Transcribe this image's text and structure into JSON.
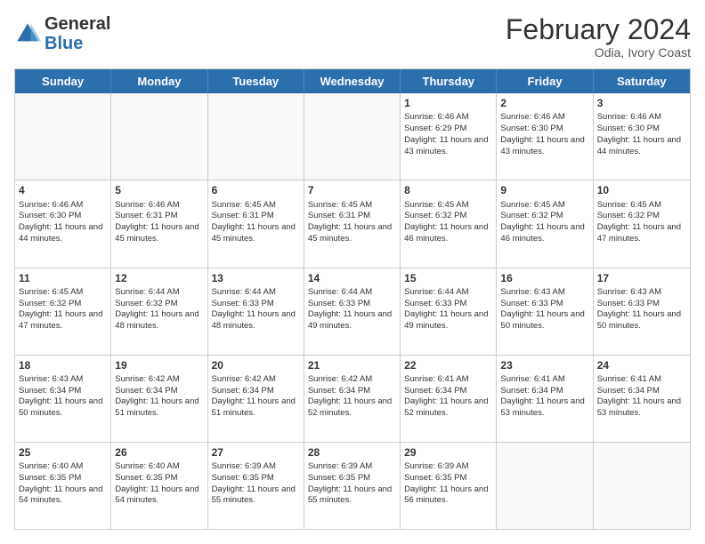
{
  "logo": {
    "general": "General",
    "blue": "Blue"
  },
  "header": {
    "month": "February 2024",
    "location": "Odia, Ivory Coast"
  },
  "days": [
    "Sunday",
    "Monday",
    "Tuesday",
    "Wednesday",
    "Thursday",
    "Friday",
    "Saturday"
  ],
  "weeks": [
    [
      {
        "day": "",
        "empty": true
      },
      {
        "day": "",
        "empty": true
      },
      {
        "day": "",
        "empty": true
      },
      {
        "day": "",
        "empty": true
      },
      {
        "day": "1",
        "sunrise": "6:46 AM",
        "sunset": "6:29 PM",
        "daylight": "11 hours and 43 minutes."
      },
      {
        "day": "2",
        "sunrise": "6:46 AM",
        "sunset": "6:30 PM",
        "daylight": "11 hours and 43 minutes."
      },
      {
        "day": "3",
        "sunrise": "6:46 AM",
        "sunset": "6:30 PM",
        "daylight": "11 hours and 44 minutes."
      }
    ],
    [
      {
        "day": "4",
        "sunrise": "6:46 AM",
        "sunset": "6:30 PM",
        "daylight": "11 hours and 44 minutes."
      },
      {
        "day": "5",
        "sunrise": "6:46 AM",
        "sunset": "6:31 PM",
        "daylight": "11 hours and 45 minutes."
      },
      {
        "day": "6",
        "sunrise": "6:45 AM",
        "sunset": "6:31 PM",
        "daylight": "11 hours and 45 minutes."
      },
      {
        "day": "7",
        "sunrise": "6:45 AM",
        "sunset": "6:31 PM",
        "daylight": "11 hours and 45 minutes."
      },
      {
        "day": "8",
        "sunrise": "6:45 AM",
        "sunset": "6:32 PM",
        "daylight": "11 hours and 46 minutes."
      },
      {
        "day": "9",
        "sunrise": "6:45 AM",
        "sunset": "6:32 PM",
        "daylight": "11 hours and 46 minutes."
      },
      {
        "day": "10",
        "sunrise": "6:45 AM",
        "sunset": "6:32 PM",
        "daylight": "11 hours and 47 minutes."
      }
    ],
    [
      {
        "day": "11",
        "sunrise": "6:45 AM",
        "sunset": "6:32 PM",
        "daylight": "11 hours and 47 minutes."
      },
      {
        "day": "12",
        "sunrise": "6:44 AM",
        "sunset": "6:32 PM",
        "daylight": "11 hours and 48 minutes."
      },
      {
        "day": "13",
        "sunrise": "6:44 AM",
        "sunset": "6:33 PM",
        "daylight": "11 hours and 48 minutes."
      },
      {
        "day": "14",
        "sunrise": "6:44 AM",
        "sunset": "6:33 PM",
        "daylight": "11 hours and 49 minutes."
      },
      {
        "day": "15",
        "sunrise": "6:44 AM",
        "sunset": "6:33 PM",
        "daylight": "11 hours and 49 minutes."
      },
      {
        "day": "16",
        "sunrise": "6:43 AM",
        "sunset": "6:33 PM",
        "daylight": "11 hours and 50 minutes."
      },
      {
        "day": "17",
        "sunrise": "6:43 AM",
        "sunset": "6:33 PM",
        "daylight": "11 hours and 50 minutes."
      }
    ],
    [
      {
        "day": "18",
        "sunrise": "6:43 AM",
        "sunset": "6:34 PM",
        "daylight": "11 hours and 50 minutes."
      },
      {
        "day": "19",
        "sunrise": "6:42 AM",
        "sunset": "6:34 PM",
        "daylight": "11 hours and 51 minutes."
      },
      {
        "day": "20",
        "sunrise": "6:42 AM",
        "sunset": "6:34 PM",
        "daylight": "11 hours and 51 minutes."
      },
      {
        "day": "21",
        "sunrise": "6:42 AM",
        "sunset": "6:34 PM",
        "daylight": "11 hours and 52 minutes."
      },
      {
        "day": "22",
        "sunrise": "6:41 AM",
        "sunset": "6:34 PM",
        "daylight": "11 hours and 52 minutes."
      },
      {
        "day": "23",
        "sunrise": "6:41 AM",
        "sunset": "6:34 PM",
        "daylight": "11 hours and 53 minutes."
      },
      {
        "day": "24",
        "sunrise": "6:41 AM",
        "sunset": "6:34 PM",
        "daylight": "11 hours and 53 minutes."
      }
    ],
    [
      {
        "day": "25",
        "sunrise": "6:40 AM",
        "sunset": "6:35 PM",
        "daylight": "11 hours and 54 minutes."
      },
      {
        "day": "26",
        "sunrise": "6:40 AM",
        "sunset": "6:35 PM",
        "daylight": "11 hours and 54 minutes."
      },
      {
        "day": "27",
        "sunrise": "6:39 AM",
        "sunset": "6:35 PM",
        "daylight": "11 hours and 55 minutes."
      },
      {
        "day": "28",
        "sunrise": "6:39 AM",
        "sunset": "6:35 PM",
        "daylight": "11 hours and 55 minutes."
      },
      {
        "day": "29",
        "sunrise": "6:39 AM",
        "sunset": "6:35 PM",
        "daylight": "11 hours and 56 minutes."
      },
      {
        "day": "",
        "empty": true
      },
      {
        "day": "",
        "empty": true
      }
    ]
  ]
}
